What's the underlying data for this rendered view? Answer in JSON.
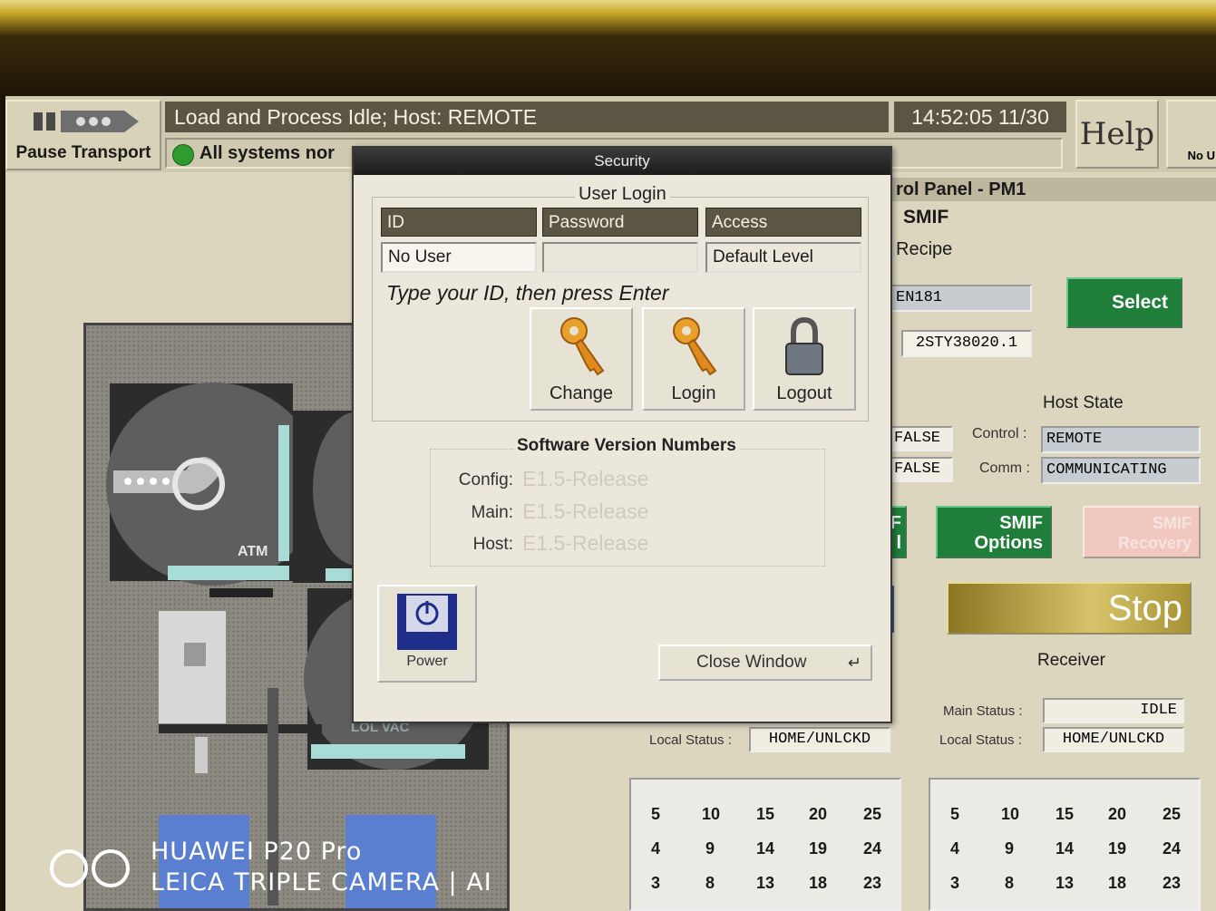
{
  "topbar": {
    "pause_label": "Pause Transport",
    "status": "Load and Process Idle; Host: REMOTE",
    "time": "14:52:05  11/30",
    "systems": "All systems nor",
    "help_label": "Help",
    "no_user_label": "No U"
  },
  "dialog": {
    "title": "Security",
    "login_group": "User Login",
    "headers": {
      "id": "ID",
      "password": "Password",
      "access": "Access"
    },
    "values": {
      "id": "No User",
      "password": "",
      "access": "Default Level"
    },
    "instruction": "Type your ID, then press Enter",
    "buttons": {
      "change": "Change",
      "login": "Login",
      "logout": "Logout"
    },
    "versions_title": "Software Version Numbers",
    "versions": [
      {
        "label": "Config:",
        "value": "E1.5-Release"
      },
      {
        "label": "Main:",
        "value": "E1.5-Release"
      },
      {
        "label": "Host:",
        "value": "E1.5-Release"
      }
    ],
    "power_label": "Power",
    "close_label": "Close Window"
  },
  "panel": {
    "title": "rol Panel - PM1",
    "smif": "SMIF",
    "recipe_label": "Recipe",
    "recipe_value": "EN181",
    "recipe_value2": "2STY38020.1",
    "select_label": "Select",
    "host_state_label": "Host  State",
    "false1": "FALSE",
    "false2": "FALSE",
    "control_label": "Control :",
    "control_value": "REMOTE",
    "comm_label": "Comm :",
    "comm_value": "COMMUNICATING",
    "partial_btn": "F\nl",
    "smif_options": "SMIF\nOptions",
    "smif_recovery": "SMIF\nRecovery",
    "stop_label": "Stop",
    "receiver_label": "Receiver",
    "sender_local_label": "Local Status :",
    "sender_local_value": "HOME/UNLCKD",
    "recv_main_label": "Main Status :",
    "recv_main_value": "IDLE",
    "recv_local_label": "Local Status :",
    "recv_local_value": "HOME/UNLCKD"
  },
  "graphic": {
    "atm_label": "ATM",
    "lolvac_label": "LOL VAC"
  },
  "slot_rows": [
    [
      "5",
      "10",
      "15",
      "20",
      "25"
    ],
    [
      "4",
      "9",
      "14",
      "19",
      "24"
    ],
    [
      "3",
      "8",
      "13",
      "18",
      "23"
    ]
  ],
  "watermark": {
    "line1": "HUAWEI P20 Pro",
    "line2": "LEICA TRIPLE CAMERA | AI"
  },
  "colors": {
    "status_bar": "#5b5644",
    "green_button": "#1f7f3a",
    "dialog_bg": "#ebe7da"
  }
}
